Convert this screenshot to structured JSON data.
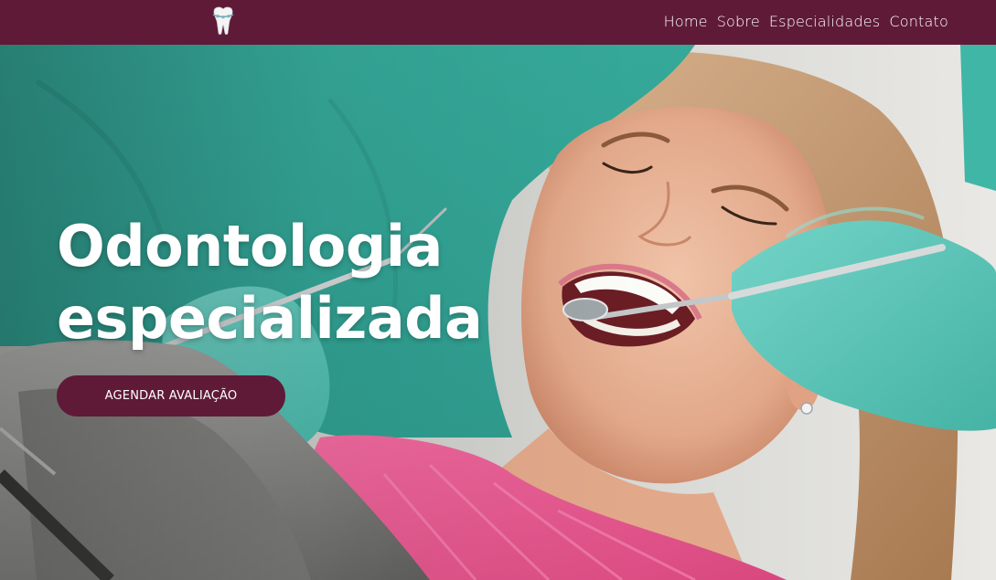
{
  "nav": {
    "logo_icon": "tooth-icon",
    "items": [
      {
        "label": "Home"
      },
      {
        "label": "Sobre"
      },
      {
        "label": "Especialidades"
      },
      {
        "label": "Contato"
      }
    ]
  },
  "hero": {
    "title_line1": "Odontologia",
    "title_line2": "especializada",
    "cta_label": "AGENDAR AVALIAÇÃO",
    "background_image": "dentist-examining-smiling-patient-photo"
  },
  "colors": {
    "brand": "#5f1a38",
    "scrub_teal": "#3fb6a6",
    "glove_teal": "#5fc8bb",
    "bib_pink": "#e85b94"
  }
}
